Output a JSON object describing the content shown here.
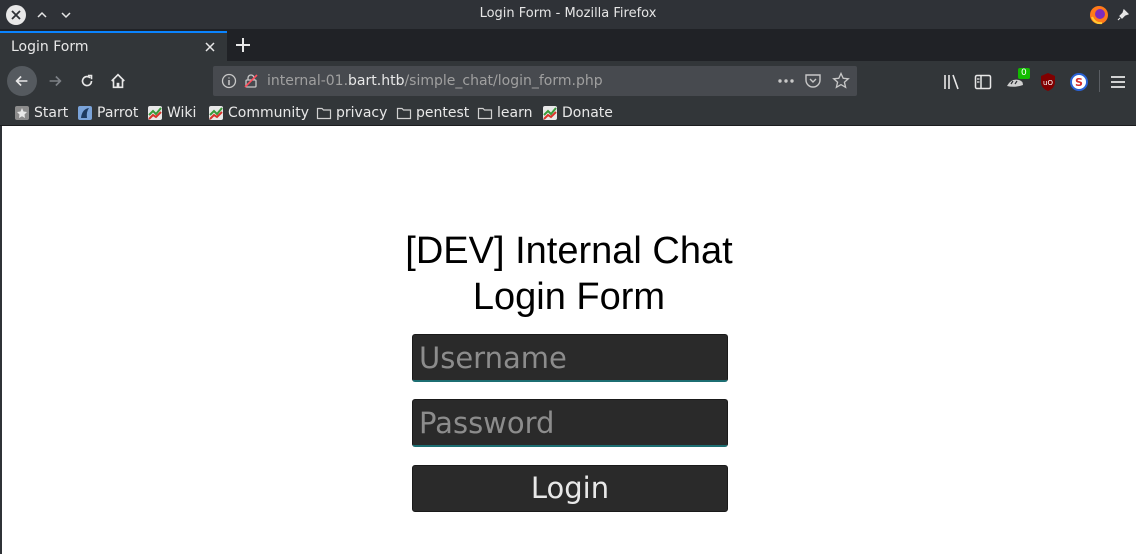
{
  "window": {
    "title": "Login Form - Mozilla Firefox"
  },
  "tabs": [
    {
      "label": "Login Form"
    }
  ],
  "urlbar": {
    "host_prefix": "internal-01.",
    "host": "bart.htb",
    "path": "/simple_chat/login_form.php"
  },
  "toolbar": {
    "extension_badge": "0"
  },
  "bookmarks": [
    {
      "label": "Start",
      "icon": "start-icon"
    },
    {
      "label": "Parrot",
      "icon": "parrot-icon"
    },
    {
      "label": "Wiki",
      "icon": "wiki-icon"
    },
    {
      "label": "Community",
      "icon": "community-icon"
    },
    {
      "label": "privacy",
      "icon": "folder-icon"
    },
    {
      "label": "pentest",
      "icon": "folder-icon"
    },
    {
      "label": "learn",
      "icon": "folder-icon"
    },
    {
      "label": "Donate",
      "icon": "donate-icon"
    }
  ],
  "page": {
    "heading_line1": "[DEV] Internal Chat",
    "heading_line2": "Login Form",
    "username_placeholder": "Username",
    "password_placeholder": "Password",
    "login_label": "Login"
  },
  "colors": {
    "chrome_dark": "#2f3237",
    "toolbar": "#323639",
    "accent": "#0a84ff",
    "field_bg": "#2a2a2a"
  }
}
